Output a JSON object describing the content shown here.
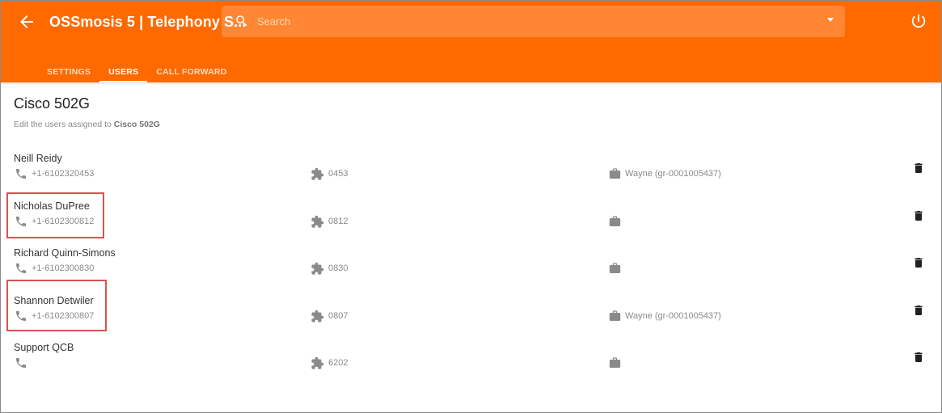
{
  "header": {
    "title": "OSSmosis 5 | Telephony S...",
    "search_placeholder": "Search"
  },
  "tabs": [
    {
      "label": "SETTINGS",
      "active": false
    },
    {
      "label": "USERS",
      "active": true
    },
    {
      "label": "CALL FORWARD",
      "active": false
    }
  ],
  "page": {
    "title": "Cisco 502G",
    "subtitle_prefix": "Edit the users assigned to",
    "subtitle_device": "Cisco 502G"
  },
  "users": [
    {
      "name": "Neill Reidy",
      "phone": "+1-6102320453",
      "extension": "0453",
      "group": "Wayne (gr-0001005437)",
      "highlighted": false
    },
    {
      "name": "Nicholas DuPree",
      "phone": "+1-6102300812",
      "extension": "0812",
      "group": "",
      "highlighted": true
    },
    {
      "name": "Richard Quinn-Simons",
      "phone": "+1-6102300830",
      "extension": "0830",
      "group": "",
      "highlighted": false
    },
    {
      "name": "Shannon Detwiler",
      "phone": "+1-6102300807",
      "extension": "0807",
      "group": "Wayne (gr-0001005437)",
      "highlighted": true
    },
    {
      "name": "Support QCB",
      "phone": "",
      "extension": "6202",
      "group": "",
      "highlighted": false
    }
  ],
  "icons": {
    "back": "arrow-left-icon",
    "search": "search-icon",
    "dropdown": "chevron-down-icon",
    "power": "power-icon",
    "phone": "phone-icon",
    "extension": "puzzle-icon",
    "group": "briefcase-icon",
    "delete": "trash-icon"
  },
  "colors": {
    "accent": "#ff6a00",
    "highlight_box": "#d9534f",
    "secondary_text": "#8a8a8a"
  }
}
